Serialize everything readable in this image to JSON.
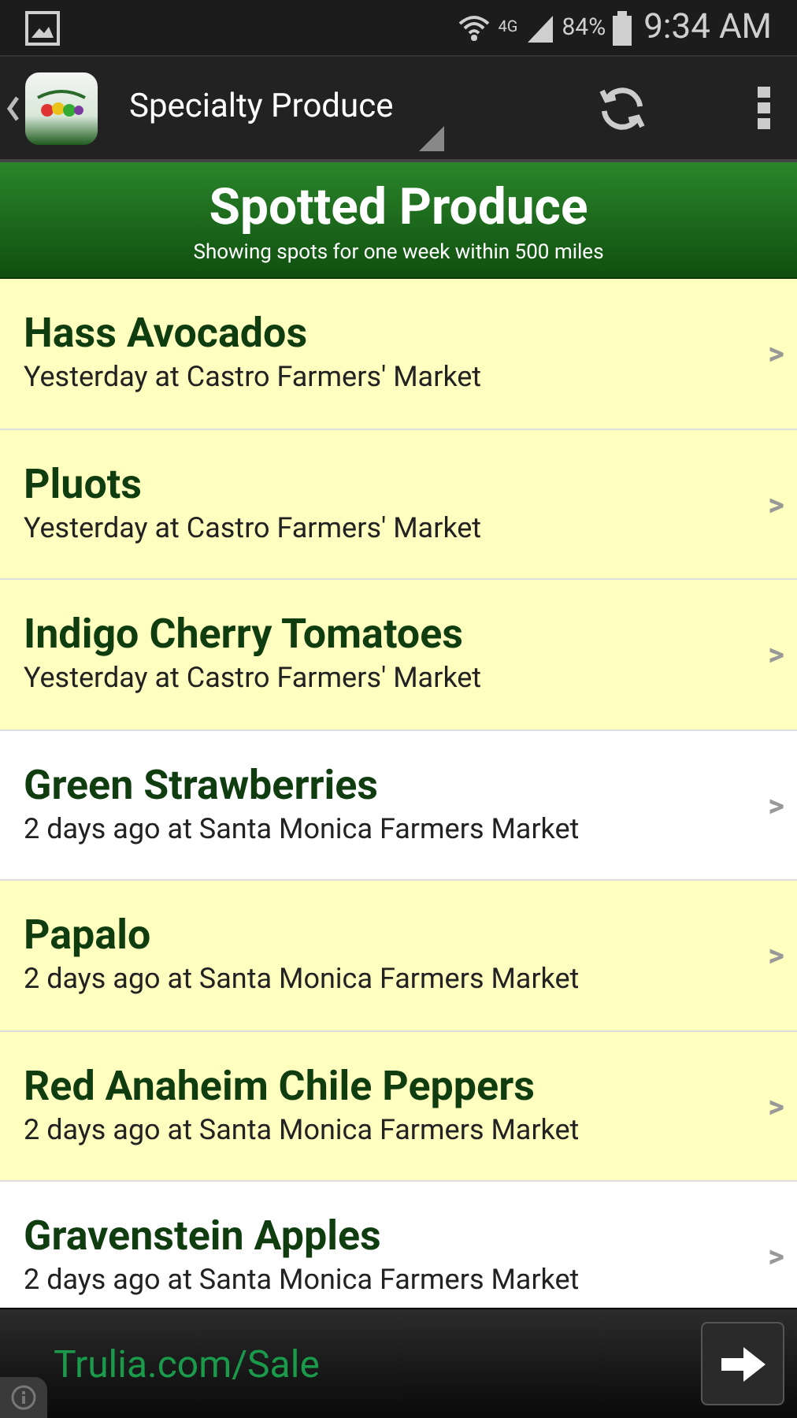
{
  "status_bar": {
    "network": "4G",
    "battery": "84%",
    "time": "9:34 AM"
  },
  "action_bar": {
    "title": "Specialty Produce"
  },
  "header": {
    "title": "Spotted Produce",
    "subtitle": "Showing spots for one week within 500 miles"
  },
  "spots": [
    {
      "name": "Hass Avocados",
      "detail": "Yesterday at Castro Farmers' Market",
      "highlighted": true,
      "chevron": ">"
    },
    {
      "name": "Pluots",
      "detail": "Yesterday at Castro Farmers' Market",
      "highlighted": true,
      "chevron": ">"
    },
    {
      "name": "Indigo Cherry Tomatoes",
      "detail": "Yesterday at Castro Farmers' Market",
      "highlighted": true,
      "chevron": ">"
    },
    {
      "name": "Green Strawberries",
      "detail": "2 days ago at Santa Monica Farmers Market",
      "highlighted": false,
      "chevron": ">"
    },
    {
      "name": "Papalo",
      "detail": "2 days ago at Santa Monica Farmers Market",
      "highlighted": true,
      "chevron": ">"
    },
    {
      "name": "Red Anaheim Chile Peppers",
      "detail": "2 days ago at Santa Monica Farmers Market",
      "highlighted": true,
      "chevron": ">"
    },
    {
      "name": "Gravenstein Apples",
      "detail": "2 days ago at Santa Monica Farmers Market",
      "highlighted": false,
      "chevron": ">"
    }
  ],
  "ad": {
    "text": "Trulia.com/Sale"
  }
}
